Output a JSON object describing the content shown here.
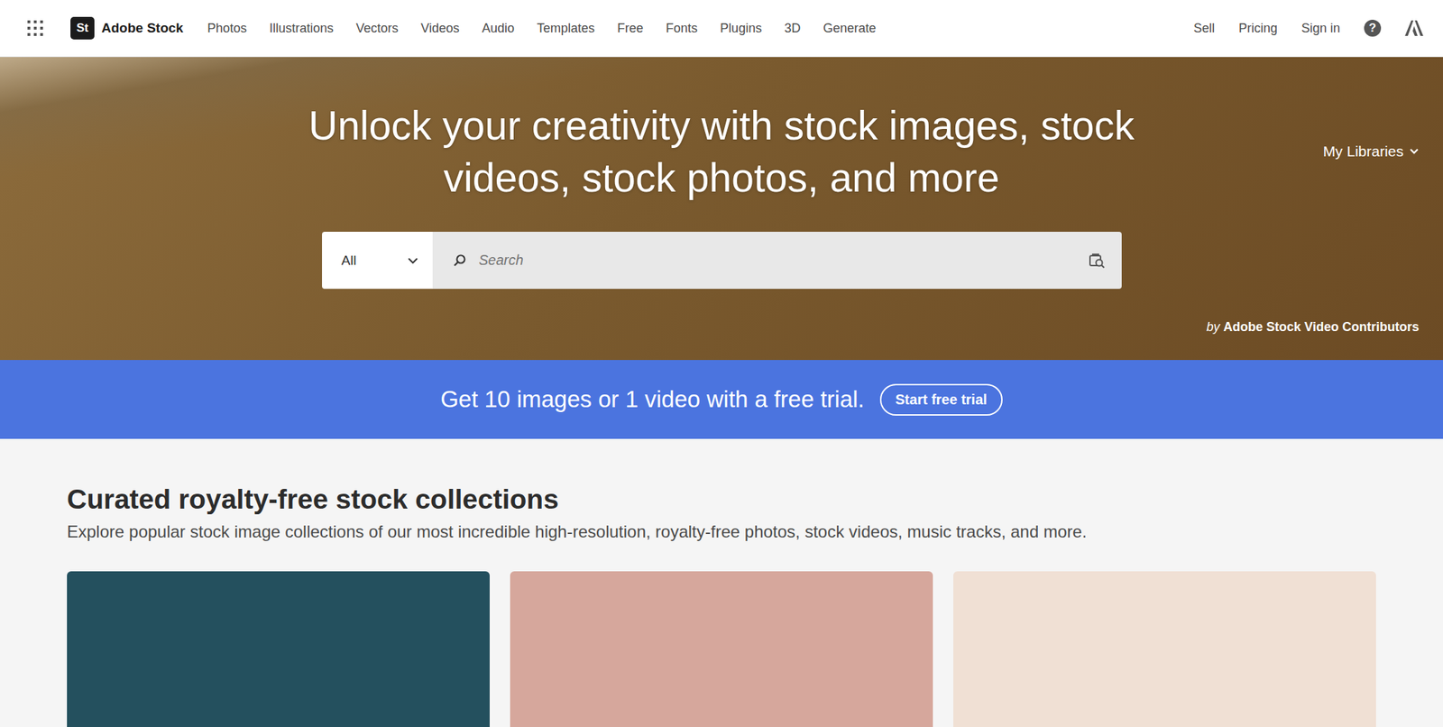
{
  "logo": {
    "mark": "St",
    "name": "Adobe Stock"
  },
  "nav": {
    "items": [
      "Photos",
      "Illustrations",
      "Vectors",
      "Videos",
      "Audio",
      "Templates",
      "Free",
      "Fonts",
      "Plugins",
      "3D",
      "Generate"
    ],
    "right_links": [
      "Sell",
      "Pricing",
      "Sign in"
    ],
    "help_icon": "?"
  },
  "hero": {
    "title": "Unlock your creativity with stock images, stock videos, stock photos, and more",
    "libraries": "My Libraries",
    "credit_prefix": "by",
    "credit_name": "Adobe Stock Video Contributors"
  },
  "search": {
    "category": "All",
    "placeholder": "Search"
  },
  "banner": {
    "text": "Get 10 images or 1 video with a free trial.",
    "button": "Start free trial"
  },
  "section": {
    "title": "Curated royalty-free stock collections",
    "subtitle": "Explore popular stock image collections of our most incredible high-resolution, royalty-free photos, stock videos, music tracks, and more."
  },
  "cards": [
    {
      "color": "#24505e"
    },
    {
      "color": "#d6a79c"
    },
    {
      "color": "#f0e0d4"
    }
  ]
}
